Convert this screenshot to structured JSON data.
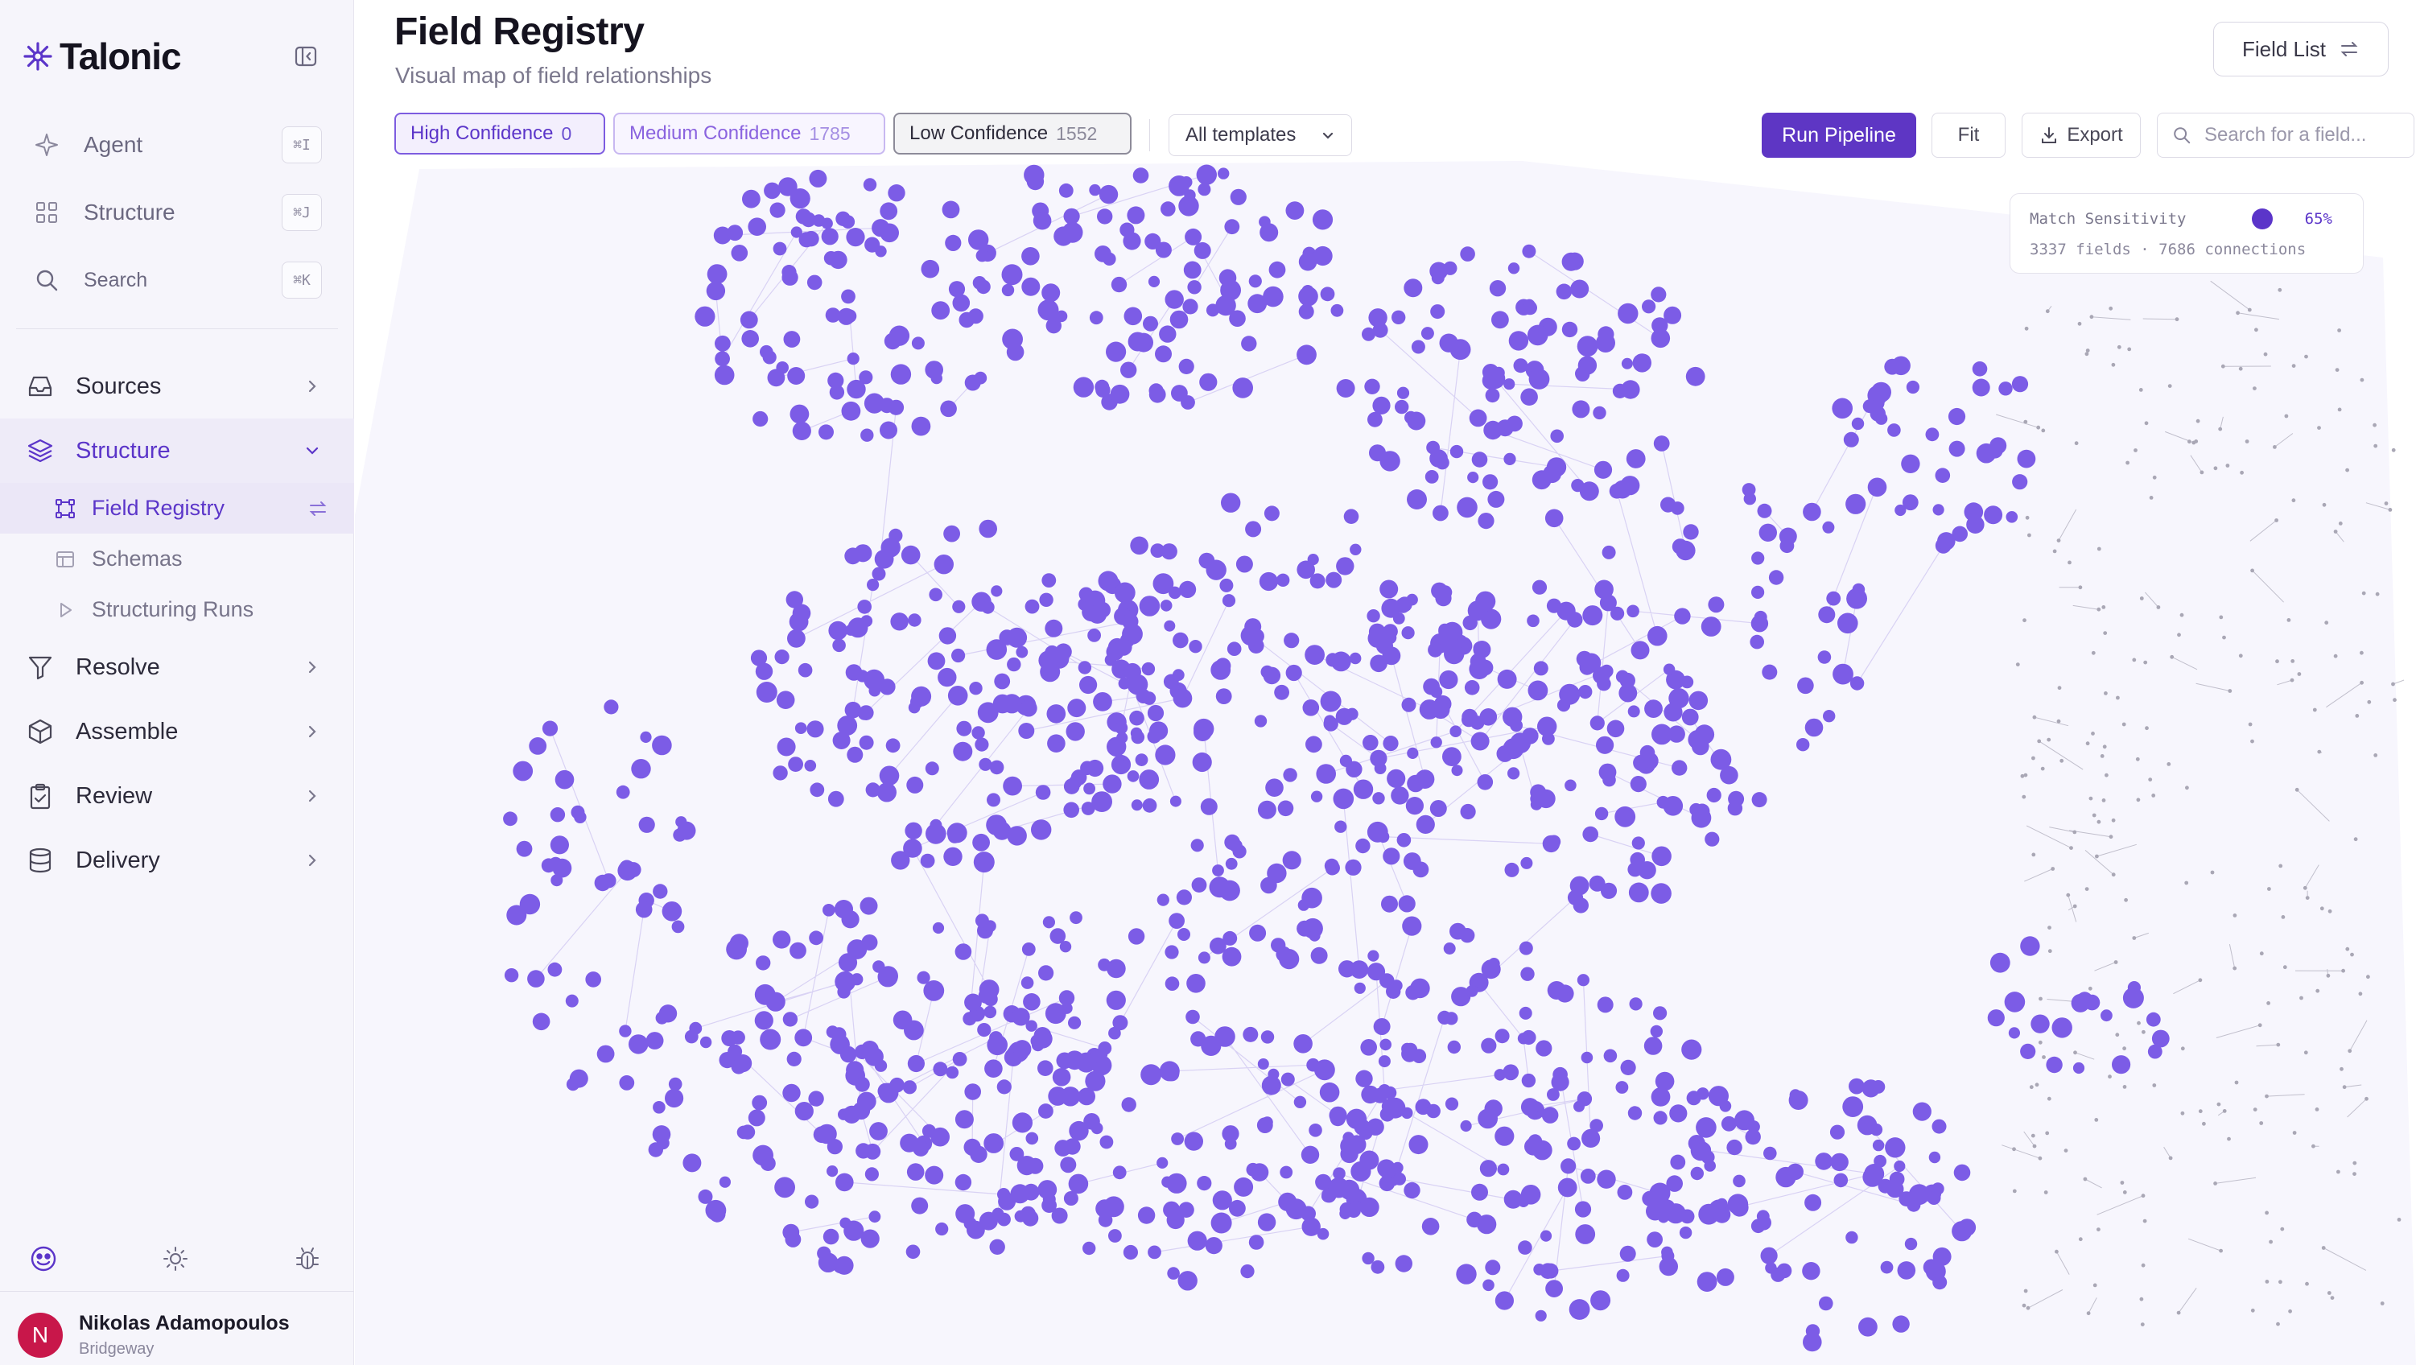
{
  "app": {
    "name": "Talonic",
    "brand_color": "#5b35c9",
    "node_color": "#7c5ce6"
  },
  "sidebar": {
    "top_items": [
      {
        "label": "Agent",
        "icon": "sparkle-icon",
        "shortcut": "⌘I"
      },
      {
        "label": "Structure",
        "icon": "grid-icon",
        "shortcut": "⌘J"
      },
      {
        "label": "Search",
        "icon": "search-icon",
        "shortcut": "⌘K"
      }
    ],
    "nav": [
      {
        "label": "Sources",
        "icon": "inbox-icon"
      },
      {
        "label": "Structure",
        "icon": "layers-icon",
        "expanded": true
      },
      {
        "label": "Resolve",
        "icon": "filter-icon"
      },
      {
        "label": "Assemble",
        "icon": "box-icon"
      },
      {
        "label": "Review",
        "icon": "clipboard-check-icon"
      },
      {
        "label": "Delivery",
        "icon": "database-icon"
      }
    ],
    "structure_children": [
      {
        "label": "Field Registry",
        "icon": "graph-icon",
        "active": true
      },
      {
        "label": "Schemas",
        "icon": "table-icon"
      },
      {
        "label": "Structuring Runs",
        "icon": "play-icon"
      }
    ],
    "tools": [
      "brand-face-icon",
      "sun-icon",
      "bug-icon"
    ],
    "user": {
      "initial": "N",
      "name": "Nikolas Adamopoulos",
      "org": "Bridgeway",
      "avatar_color": "#c8174a"
    }
  },
  "header": {
    "title": "Field Registry",
    "subtitle": "Visual map of field relationships",
    "field_list_label": "Field List"
  },
  "toolbar": {
    "chips": {
      "high": {
        "label": "High Confidence",
        "count": "0"
      },
      "medium": {
        "label": "Medium Confidence",
        "count": "1785"
      },
      "low": {
        "label": "Low Confidence",
        "count": "1552"
      }
    },
    "template_select": {
      "value": "All templates"
    },
    "run_label": "Run Pipeline",
    "fit_label": "Fit",
    "export_label": "Export",
    "search_placeholder": "Search for a field..."
  },
  "graph_panel": {
    "sensitivity_label": "Match Sensitivity",
    "sensitivity_value": "65%",
    "stats": "3337 fields · 7686 connections"
  }
}
